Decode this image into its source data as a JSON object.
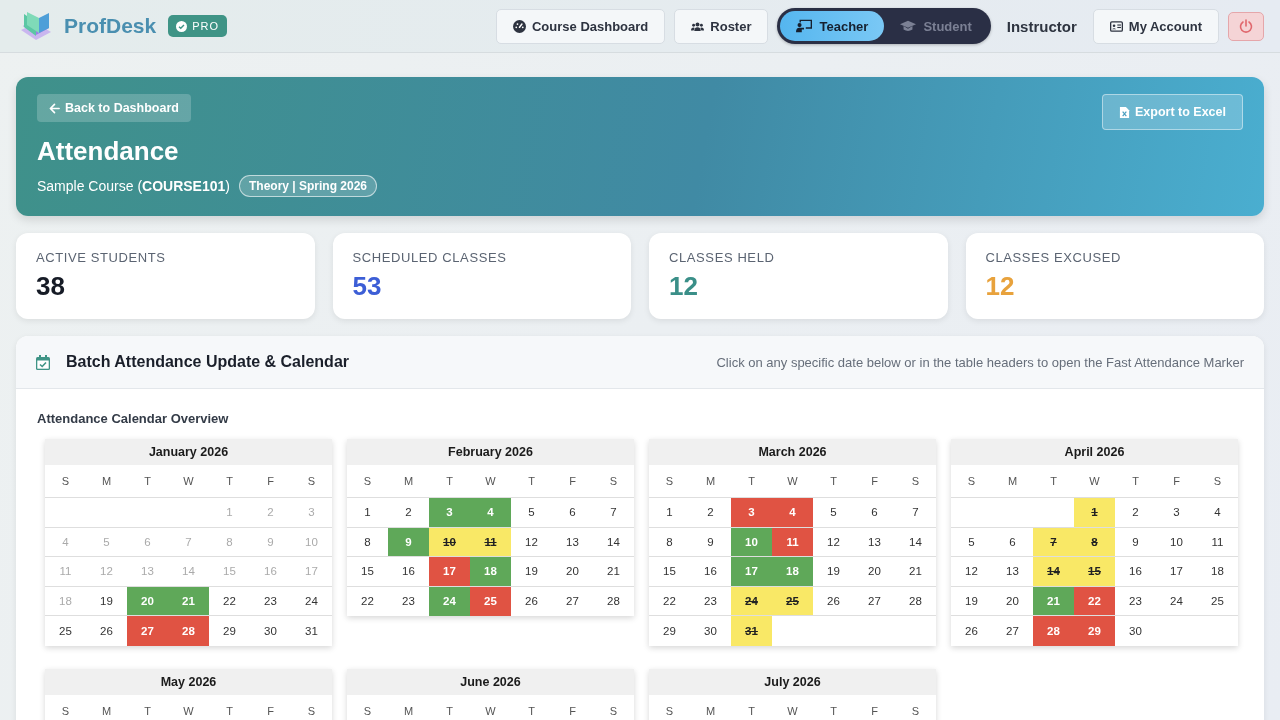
{
  "app": {
    "name": "ProfDesk",
    "badge": "PRO"
  },
  "nav": {
    "buttons": [
      {
        "kind": "dashboard",
        "label": "Course Dashboard"
      },
      {
        "kind": "roster",
        "label": "Roster"
      }
    ],
    "modes": [
      {
        "kind": "teacher",
        "label": "Teacher",
        "selected": true
      },
      {
        "kind": "student",
        "label": "Student",
        "selected": false
      }
    ],
    "role": "Instructor",
    "account": "My Account"
  },
  "hero": {
    "back": "Back to Dashboard",
    "export": "Export to Excel",
    "title": "Attendance",
    "course": "Sample Course (**COURSE101**)",
    "tag": "Theory | Spring 2026"
  },
  "stats": [
    {
      "label": "ACTIVE STUDENTS",
      "value": "38",
      "color": "#161b26"
    },
    {
      "label": "SCHEDULED CLASSES",
      "value": "53",
      "color": "#3c5ed6"
    },
    {
      "label": "CLASSES HELD",
      "value": "12",
      "color": "#3a8f88"
    },
    {
      "label": "CLASSES EXCUSED",
      "value": "12",
      "color": "#e8a23c"
    }
  ],
  "panel": {
    "title": "Batch Attendance Update & Calendar",
    "hint": "Click on any specific date below or in the table headers to open the Fast Attendance Marker",
    "subtitle": "Attendance Calendar Overview",
    "months": [
      {
        "title": "January 2026",
        "weekdays": [
          "S",
          "M",
          "T",
          "W",
          "T",
          "F",
          "S"
        ],
        "weeks": [
          [
            {
              "day": "1",
              "kind": "muted"
            },
            {
              "day": "2",
              "kind": "muted"
            },
            {
              "day": "3",
              "kind": "muted"
            }
          ],
          [
            {
              "day": "4",
              "kind": "muted"
            },
            {
              "day": "5",
              "kind": "muted"
            },
            {
              "day": "6",
              "kind": "muted"
            },
            {
              "day": "7",
              "kind": "muted"
            },
            {
              "day": "8",
              "kind": "muted"
            },
            {
              "day": "9",
              "kind": "muted"
            },
            {
              "day": "10",
              "kind": "muted"
            }
          ],
          [
            {
              "day": "11",
              "kind": "muted"
            },
            {
              "day": "12",
              "kind": "muted"
            },
            {
              "day": "13",
              "kind": "muted"
            },
            {
              "day": "14",
              "kind": "muted"
            },
            {
              "day": "15",
              "kind": "muted"
            },
            {
              "day": "16",
              "kind": "muted"
            },
            {
              "day": "17",
              "kind": "muted"
            }
          ],
          [
            {
              "day": "18",
              "kind": "muted"
            },
            {
              "day": "19",
              "kind": "plain"
            },
            {
              "day": "20",
              "kind": "held"
            },
            {
              "day": "21",
              "kind": "held"
            },
            {
              "day": "22",
              "kind": "plain"
            },
            {
              "day": "23",
              "kind": "plain"
            },
            {
              "day": "24",
              "kind": "plain"
            }
          ],
          [
            {
              "day": "25",
              "kind": "plain"
            },
            {
              "day": "26",
              "kind": "plain"
            },
            {
              "day": "27",
              "kind": "absent"
            },
            {
              "day": "28",
              "kind": "absent"
            },
            {
              "day": "29",
              "kind": "plain"
            },
            {
              "day": "30",
              "kind": "plain"
            },
            {
              "day": "31",
              "kind": "plain"
            }
          ]
        ]
      },
      {
        "title": "February 2026",
        "weekdays": [
          "S",
          "M",
          "T",
          "W",
          "T",
          "F",
          "S"
        ],
        "weeks": [
          [
            {
              "day": "1",
              "kind": "plain"
            },
            {
              "day": "2",
              "kind": "plain"
            },
            {
              "day": "3",
              "kind": "held"
            },
            {
              "day": "4",
              "kind": "held"
            },
            {
              "day": "5",
              "kind": "plain"
            },
            {
              "day": "6",
              "kind": "plain"
            },
            {
              "day": "7",
              "kind": "plain"
            }
          ],
          [
            {
              "day": "8",
              "kind": "plain"
            },
            {
              "day": "9",
              "kind": "held"
            },
            {
              "day": "10",
              "kind": "excused"
            },
            {
              "day": "11",
              "kind": "excused"
            },
            {
              "day": "12",
              "kind": "plain"
            },
            {
              "day": "13",
              "kind": "plain"
            },
            {
              "day": "14",
              "kind": "plain"
            }
          ],
          [
            {
              "day": "15",
              "kind": "plain"
            },
            {
              "day": "16",
              "kind": "plain"
            },
            {
              "day": "17",
              "kind": "absent"
            },
            {
              "day": "18",
              "kind": "held"
            },
            {
              "day": "19",
              "kind": "plain"
            },
            {
              "day": "20",
              "kind": "plain"
            },
            {
              "day": "21",
              "kind": "plain"
            }
          ],
          [
            {
              "day": "22",
              "kind": "plain"
            },
            {
              "day": "23",
              "kind": "plain"
            },
            {
              "day": "24",
              "kind": "held"
            },
            {
              "day": "25",
              "kind": "absent"
            },
            {
              "day": "26",
              "kind": "plain"
            },
            {
              "day": "27",
              "kind": "plain"
            },
            {
              "day": "28",
              "kind": "plain"
            }
          ]
        ]
      },
      {
        "title": "March 2026",
        "weekdays": [
          "S",
          "M",
          "T",
          "W",
          "T",
          "F",
          "S"
        ],
        "weeks": [
          [
            {
              "day": "1",
              "kind": "plain"
            },
            {
              "day": "2",
              "kind": "plain"
            },
            {
              "day": "3",
              "kind": "absent"
            },
            {
              "day": "4",
              "kind": "absent"
            },
            {
              "day": "5",
              "kind": "plain"
            },
            {
              "day": "6",
              "kind": "plain"
            },
            {
              "day": "7",
              "kind": "plain"
            }
          ],
          [
            {
              "day": "8",
              "kind": "plain"
            },
            {
              "day": "9",
              "kind": "plain"
            },
            {
              "day": "10",
              "kind": "held"
            },
            {
              "day": "11",
              "kind": "absent"
            },
            {
              "day": "12",
              "kind": "plain"
            },
            {
              "day": "13",
              "kind": "plain"
            },
            {
              "day": "14",
              "kind": "plain"
            }
          ],
          [
            {
              "day": "15",
              "kind": "plain"
            },
            {
              "day": "16",
              "kind": "plain"
            },
            {
              "day": "17",
              "kind": "held"
            },
            {
              "day": "18",
              "kind": "held"
            },
            {
              "day": "19",
              "kind": "plain"
            },
            {
              "day": "20",
              "kind": "plain"
            },
            {
              "day": "21",
              "kind": "plain"
            }
          ],
          [
            {
              "day": "22",
              "kind": "plain"
            },
            {
              "day": "23",
              "kind": "plain"
            },
            {
              "day": "24",
              "kind": "excused"
            },
            {
              "day": "25",
              "kind": "excused"
            },
            {
              "day": "26",
              "kind": "plain"
            },
            {
              "day": "27",
              "kind": "plain"
            },
            {
              "day": "28",
              "kind": "plain"
            }
          ],
          [
            {
              "day": "29",
              "kind": "plain"
            },
            {
              "day": "30",
              "kind": "plain"
            },
            {
              "day": "31",
              "kind": "excused"
            }
          ]
        ]
      },
      {
        "title": "April 2026",
        "weekdays": [
          "S",
          "M",
          "T",
          "W",
          "T",
          "F",
          "S"
        ],
        "weeks": [
          [
            {
              "day": "1",
              "kind": "excused"
            },
            {
              "day": "2",
              "kind": "plain"
            },
            {
              "day": "3",
              "kind": "plain"
            },
            {
              "day": "4",
              "kind": "plain"
            }
          ],
          [
            {
              "day": "5",
              "kind": "plain"
            },
            {
              "day": "6",
              "kind": "plain"
            },
            {
              "day": "7",
              "kind": "excused"
            },
            {
              "day": "8",
              "kind": "excused"
            },
            {
              "day": "9",
              "kind": "plain"
            },
            {
              "day": "10",
              "kind": "plain"
            },
            {
              "day": "11",
              "kind": "plain"
            }
          ],
          [
            {
              "day": "12",
              "kind": "plain"
            },
            {
              "day": "13",
              "kind": "plain"
            },
            {
              "day": "14",
              "kind": "excused"
            },
            {
              "day": "15",
              "kind": "excused"
            },
            {
              "day": "16",
              "kind": "plain"
            },
            {
              "day": "17",
              "kind": "plain"
            },
            {
              "day": "18",
              "kind": "plain"
            }
          ],
          [
            {
              "day": "19",
              "kind": "plain"
            },
            {
              "day": "20",
              "kind": "plain"
            },
            {
              "day": "21",
              "kind": "held"
            },
            {
              "day": "22",
              "kind": "absent"
            },
            {
              "day": "23",
              "kind": "plain"
            },
            {
              "day": "24",
              "kind": "plain"
            },
            {
              "day": "25",
              "kind": "plain"
            }
          ],
          [
            {
              "day": "26",
              "kind": "plain"
            },
            {
              "day": "27",
              "kind": "plain"
            },
            {
              "day": "28",
              "kind": "absent"
            },
            {
              "day": "29",
              "kind": "absent"
            },
            {
              "day": "30",
              "kind": "plain"
            }
          ]
        ]
      },
      {
        "title": "May 2026",
        "weekdays": [
          "S",
          "M",
          "T",
          "W",
          "T",
          "F",
          "S"
        ]
      },
      {
        "title": "June 2026",
        "weekdays": [
          "S",
          "M",
          "T",
          "W",
          "T",
          "F",
          "S"
        ]
      },
      {
        "title": "July 2026",
        "weekdays": [
          "S",
          "M",
          "T",
          "W",
          "T",
          "F",
          "S"
        ]
      }
    ]
  }
}
